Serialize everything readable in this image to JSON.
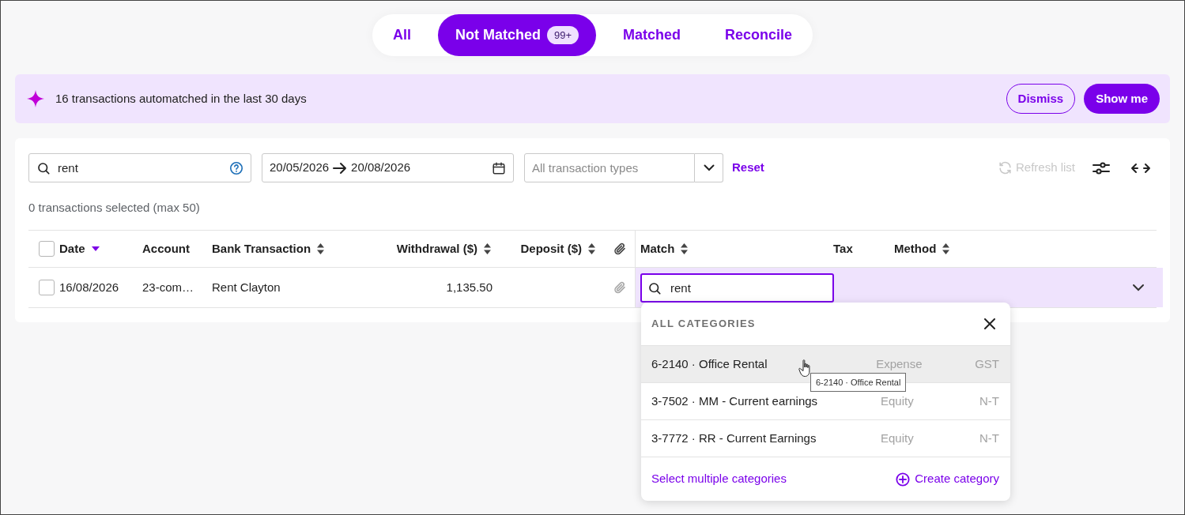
{
  "tabs": [
    {
      "label": "All",
      "selected": false
    },
    {
      "label": "Not Matched",
      "selected": true,
      "badge": "99+"
    },
    {
      "label": "Matched",
      "selected": false
    },
    {
      "label": "Reconcile",
      "selected": false
    }
  ],
  "banner": {
    "text": "16 transactions automatched in the last 30 days",
    "buttons": [
      {
        "label": "Dismiss",
        "kind": "outline"
      },
      {
        "label": "Show me",
        "kind": "filled"
      }
    ]
  },
  "filters": {
    "search": {
      "value": "rent"
    },
    "date_range": {
      "start": "20/05/2026",
      "end": "20/08/2026"
    },
    "type_select": {
      "placeholder": "All transaction types"
    },
    "reset": "Reset",
    "refresh": {
      "label": "Refresh list",
      "disabled": true
    }
  },
  "selection_count": "0 transactions selected (max 50)",
  "table": {
    "select_all": {
      "checked": false
    },
    "columns": [
      {
        "label": "Date",
        "sortable": true,
        "sorted": true,
        "kind": "text"
      },
      {
        "label": "Account",
        "kind": "text"
      },
      {
        "label": "Bank Transaction",
        "sortable": true,
        "sorted": false,
        "kind": "text"
      },
      {
        "label": "Withdrawal ($)",
        "sortable": true,
        "sorted": false,
        "kind": "text"
      },
      {
        "label": "Deposit ($)",
        "sortable": true,
        "sorted": false,
        "kind": "text"
      },
      {
        "kind": "attachment"
      },
      {
        "label": "Match",
        "sortable": true,
        "sorted": false,
        "kind": "text"
      },
      {
        "label": "Tax",
        "kind": "text"
      },
      {
        "label": "Method",
        "sortable": true,
        "sorted": false,
        "kind": "text"
      }
    ],
    "rows": [
      {
        "checked": false,
        "editing": true,
        "date": "16/08/2026",
        "account": "23-com…",
        "description": "Rent Clayton",
        "withdrawal": "1,135.50",
        "match_query": "rent"
      }
    ]
  },
  "category_dropdown": {
    "title": "ALL CATEGORIES",
    "options": [
      {
        "label": "6-2140 · Office Rental",
        "type": "Expense",
        "tax": "GST",
        "hovered": true
      },
      {
        "label": "3-7502 · MM - Current earnings",
        "type": "Equity",
        "tax": "N-T",
        "hovered": false
      },
      {
        "label": "3-7772 · RR - Current Earnings",
        "type": "Equity",
        "tax": "N-T",
        "hovered": false
      }
    ],
    "select_multiple": "Select multiple categories",
    "create": "Create category"
  },
  "tooltip": "6-2140 · Office Rental"
}
